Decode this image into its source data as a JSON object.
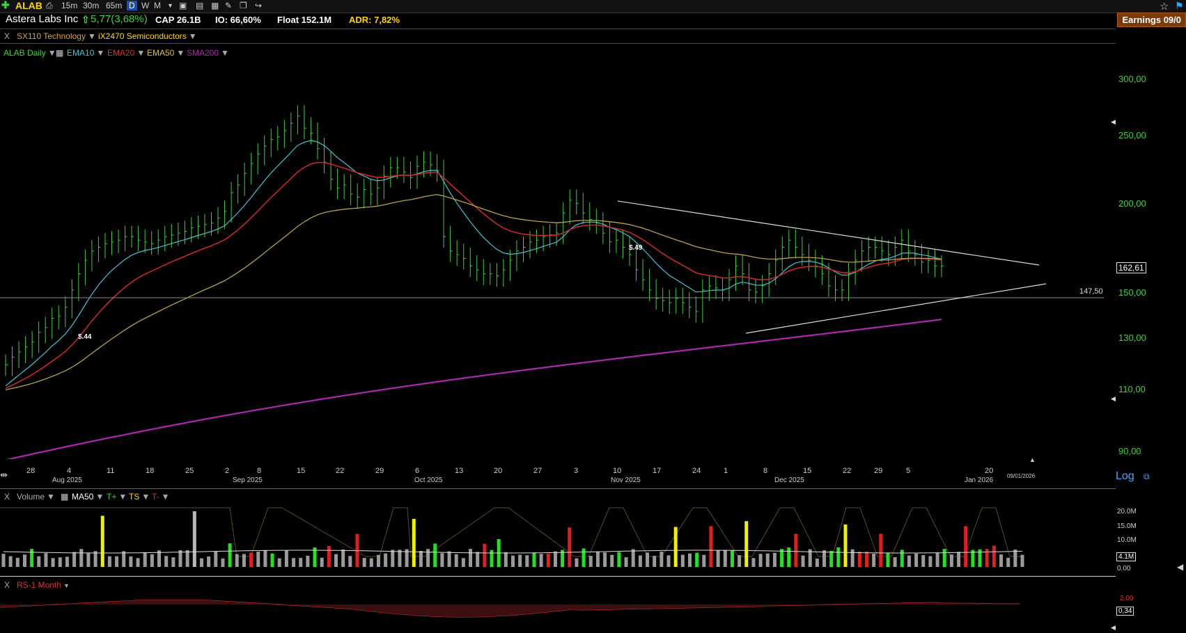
{
  "toolbar": {
    "ticker": "ALAB",
    "timeframes": [
      "15m",
      "30m",
      "65m",
      "D",
      "W",
      "M"
    ]
  },
  "header": {
    "company": "Astera Labs Inc",
    "change": "5,77(3,68%)",
    "cap": "CAP 26.1B",
    "io": "IO: 66,60%",
    "float": "Float 152.1M",
    "adr": "ADR: 7,82%",
    "earnings": "Earnings 09/0"
  },
  "sectors": {
    "close": "X",
    "sector": "SX110 Technology",
    "industry": "iX2470 Semiconductors"
  },
  "indicators": {
    "daily": "ALAB Daily",
    "ema10": "EMA10",
    "ema20": "EMA20",
    "ema50": "EMA50",
    "sma200": "SMA200"
  },
  "colors": {
    "up": "#3cd33c",
    "ema10": "#3cc8d8",
    "ema20": "#c8282a",
    "ema50": "#c8b43c",
    "sma200": "#b026b0",
    "vol_gray": "#9a9a9a",
    "vol_green": "#22e022",
    "vol_red": "#e02020",
    "vol_yellow": "#f0f000"
  },
  "price_axis": {
    "ticks": [
      "300,00",
      "250,00",
      "200,00",
      "150,00",
      "130,00",
      "110,00",
      "90,00"
    ],
    "last_price": "162,61",
    "level_label": "147,50",
    "scale_label": "Log"
  },
  "date_axis": {
    "days": [
      "28",
      "4",
      "11",
      "18",
      "25",
      "2",
      "8",
      "15",
      "22",
      "29",
      "6",
      "13",
      "20",
      "27",
      "3",
      "10",
      "17",
      "24",
      "1",
      "8",
      "15",
      "22",
      "29",
      "5",
      "20"
    ],
    "months": [
      "Aug 2025",
      "Sep 2025",
      "Oct 2025",
      "Nov 2025",
      "Dec 2025",
      "Jan 2026"
    ],
    "cursor_date": "09/01/2026"
  },
  "annotations": {
    "earnings_marker_1": "$.44",
    "earnings_marker_2": "$.49"
  },
  "volume_pane": {
    "close": "X",
    "label": "Volume",
    "ma": "MA50",
    "tplus": "T+",
    "ts": "TS",
    "tminus": "T-",
    "ticks": [
      "20.0M",
      "15.0M",
      "10.0M",
      "0.00"
    ],
    "current": "4.1M"
  },
  "rs_pane": {
    "close": "X",
    "label": "RS-1 Month",
    "ticks": [
      "2.00"
    ],
    "current": "0,34"
  },
  "chart_data": {
    "type": "ohlc",
    "title": "ALAB Daily",
    "log_scale": true,
    "ylim": [
      85,
      320
    ],
    "price_levels": {
      "horizontal": 147.5
    },
    "series": [
      {
        "name": "EMA10"
      },
      {
        "name": "EMA20"
      },
      {
        "name": "EMA50"
      },
      {
        "name": "SMA200"
      }
    ],
    "closes_approx": [
      118,
      121,
      123,
      125,
      127,
      131,
      133,
      137,
      138,
      142,
      150,
      158,
      165,
      170,
      172,
      174,
      175,
      176,
      178,
      178,
      176,
      175,
      174,
      176,
      178,
      179,
      180,
      181,
      183,
      184,
      185,
      186,
      189,
      193,
      205,
      210,
      218,
      225,
      232,
      238,
      243,
      245,
      250,
      256,
      262,
      252,
      248,
      236,
      226,
      214,
      208,
      210,
      204,
      202,
      207,
      204,
      208,
      216,
      222,
      222,
      219,
      215,
      223,
      226,
      224,
      220,
      178,
      170,
      168,
      166,
      162,
      160,
      158,
      158,
      157,
      160,
      165,
      170,
      172,
      175,
      176,
      178,
      179,
      180,
      192,
      200,
      198,
      192,
      188,
      186,
      180,
      175,
      176,
      172,
      168,
      160,
      155,
      150,
      146,
      145,
      144,
      146,
      144,
      142,
      140,
      150,
      152,
      151,
      150,
      155,
      162,
      158,
      150,
      149,
      152,
      158,
      165,
      172,
      176,
      172,
      168,
      165,
      162,
      158,
      152,
      150,
      150,
      158,
      165,
      170,
      172,
      172,
      170,
      168,
      172,
      176,
      170,
      168,
      164,
      165,
      162,
      162
    ]
  }
}
